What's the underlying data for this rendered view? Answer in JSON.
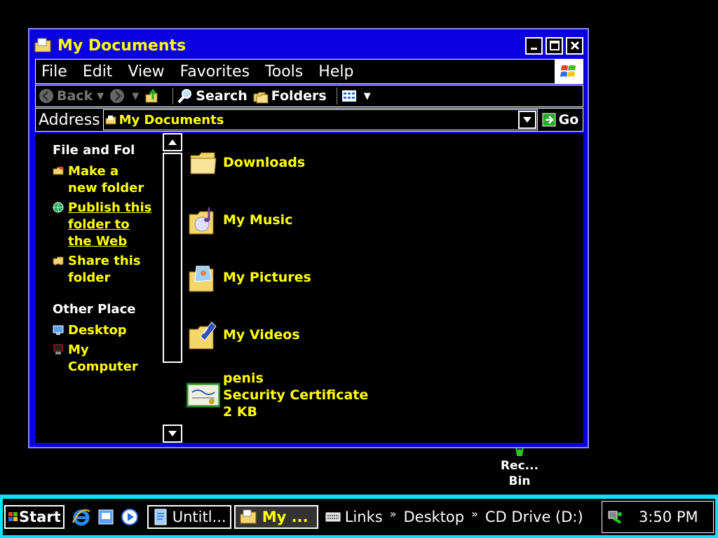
{
  "window": {
    "title": "My Documents",
    "menu": [
      "File",
      "Edit",
      "View",
      "Favorites",
      "Tools",
      "Help"
    ],
    "toolbar": {
      "back": "Back",
      "search": "Search",
      "folders": "Folders"
    },
    "address": {
      "label": "Address",
      "value": "My Documents",
      "go": "Go"
    }
  },
  "taskpane": {
    "file_folder_heading": "File and Fol",
    "file_tasks": [
      {
        "label": "Make a new folder",
        "icon": "new-folder-icon"
      },
      {
        "label": "Publish this folder to the Web",
        "icon": "globe-icon"
      },
      {
        "label": "Share this folder",
        "icon": "share-folder-icon"
      }
    ],
    "other_places_heading": "Other Place",
    "other_places": [
      {
        "label": "Desktop",
        "icon": "desktop-icon"
      },
      {
        "label": "My Computer",
        "icon": "my-computer-icon"
      }
    ]
  },
  "files": [
    {
      "name": "Downloads",
      "icon": "folder-icon"
    },
    {
      "name": "My Music",
      "icon": "music-folder-icon"
    },
    {
      "name": "My Pictures",
      "icon": "pictures-folder-icon"
    },
    {
      "name": "My Videos",
      "icon": "videos-folder-icon"
    },
    {
      "name": "penis",
      "type": "Security Certificate",
      "size": "2 KB",
      "icon": "certificate-icon"
    }
  ],
  "desktop": {
    "recycle_bin_label": "Rec... Bin"
  },
  "taskbar": {
    "start": "Start",
    "tasks": [
      "Untitl...",
      "My ..."
    ],
    "links": [
      "Links",
      "Desktop",
      "CD Drive (D:)"
    ],
    "clock": "3:50 PM"
  },
  "colors": {
    "window_frame": "#0a00e0",
    "text_highlight": "#ffff00",
    "taskbar": "#00e5ff"
  }
}
